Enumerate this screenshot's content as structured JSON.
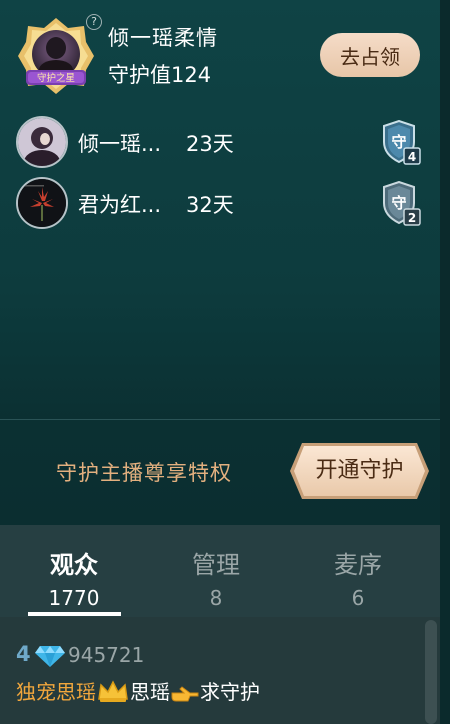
{
  "top_guardian": {
    "badge_text": "守护之星",
    "name": "倾一瑶柔情",
    "guard_value": "守护值124",
    "occupy_label": "去占领"
  },
  "guardians": [
    {
      "name": "倾一瑶...",
      "days": "23天",
      "level": "4"
    },
    {
      "name": "君为红...",
      "days": "32天",
      "level": "2"
    }
  ],
  "privilege": {
    "text": "守护主播尊享特权",
    "button_label": "开通守护"
  },
  "tabs": [
    {
      "label": "观众",
      "count": "1770",
      "active": true
    },
    {
      "label": "管理",
      "count": "8",
      "active": false
    },
    {
      "label": "麦序",
      "count": "6",
      "active": false
    }
  ],
  "viewer": {
    "level": "4",
    "id": "945721",
    "msg_name": "独宠思瑶",
    "msg_mid": "思瑶",
    "msg_end": "求守护"
  },
  "colors": {
    "accent_gold": "#e3b07f",
    "button_bg": "#f5dcc8",
    "name_orange": "#f2a73c"
  }
}
